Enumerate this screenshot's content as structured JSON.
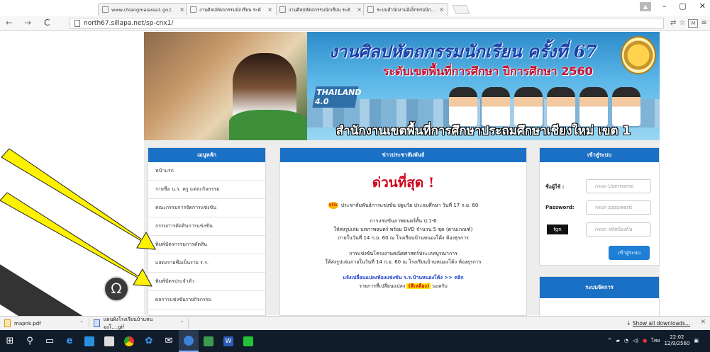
{
  "browser": {
    "tabs": [
      {
        "title": "www.chiangmaiarea1.go.t"
      },
      {
        "title": "งานศิลปหัตถกรรมนักเรียน ระดั"
      },
      {
        "title": "งานศิลปหัตถกรรมนักเรียน ระดั"
      },
      {
        "title": "ระบบสำนักงานอิเล็กทรอนิกส์ ร"
      }
    ],
    "url": "north67.sillapa.net/sp-cnx1/",
    "profile_initial": "M"
  },
  "banner": {
    "title": "งานศิลปหัตถกรรมนักเรียน ครั้งที่ 67",
    "subtitle": "ระดับเขตพื้นที่การศึกษา ปีการศึกษา 2560",
    "badge": "THAILAND 4.0",
    "office": "สำนักงานเขตพื้นที่การศึกษาประถมศึกษาเชียงใหม่ เขต 1"
  },
  "menu": {
    "header": "เมนูหลัก",
    "items": [
      "หน้าแรก",
      "รายชื่อ น.ร. ครู แต่ละกิจกรรม",
      "คณะกรรมการจัดการแข่งขัน",
      "กรรมการตัดสินการแข่งขัน",
      "พิมพ์บัตรกรรมการตัดสิน",
      "แสดงรายชื่อเป็นราย ร.ร.",
      "พิมพ์บัตรประจำตัว",
      "ผลการแข่งขันรายกิจกรรม"
    ]
  },
  "news": {
    "header": "ข่าวประชาสัมพันธ์",
    "headline": "ด่วนที่สุด !",
    "line1": "ประชาสัมพันธ์การแข่งขัน ปฐมวัย ประถมศึกษา วันที่ 17 ก.ย. 60",
    "p2a": "การแข่งขันภาพยนตร์สั้น ป.1-6",
    "p2b": "ให้ส่งรูปเล่ม บทภาพยนตร์ พร้อม DVD  จำนวน 5 ชุด (ตามเกณฑ์)",
    "p2c": "ภายในวันที่ 14 ก.ย. 60 ณ โรงเรียนบ้านหนองโค้ง ห้องธุรการ",
    "p3a": "การแข่งขันโครงงานคณิตศาสตร์ประเภทบูรณาการ",
    "p3b": "ให้ส่งรูปเล่มภายในวันที่ 14 ก.ย. 60 ณ โรงเรียนบ้านหนองโค้ง ห้องธุรการ",
    "p4a": "แจ้งเปลี่ยนแปลงห้องแข่งขัน ร.ร.บ้านหนองโค้ง >> คลิก",
    "p4b_pre": "รายการที่เปลี่ยนแปลง",
    "p4b_hl": "(สีเหลือง)",
    "p4b_post": "นะครับ"
  },
  "login": {
    "header": "เข้าสู่ระบบ",
    "user_label": "ชื่อผู้ใช้ :",
    "user_placeholder": "กรอก Username",
    "pass_label": "Password:",
    "pass_placeholder": "กรอก password",
    "captcha": "fgn",
    "captcha_placeholder": "กรอก รหัสป้องกัน",
    "button": "เข้าสู่ระบบ"
  },
  "system": {
    "header": "ระบบจัดการ"
  },
  "downloads": {
    "items": [
      "mapnk.pdf",
      "แผนผังโรงเรียนบ้านหนองโ....gif"
    ],
    "show_all": "Show all downloads..."
  },
  "taskbar": {
    "time": "22:02",
    "date": "12/9/2560",
    "lang": "ไทย"
  },
  "colors": {
    "header_blue": "#1a70c4",
    "headline_red": "#d0021b",
    "arrow_yellow": "#fff200"
  }
}
